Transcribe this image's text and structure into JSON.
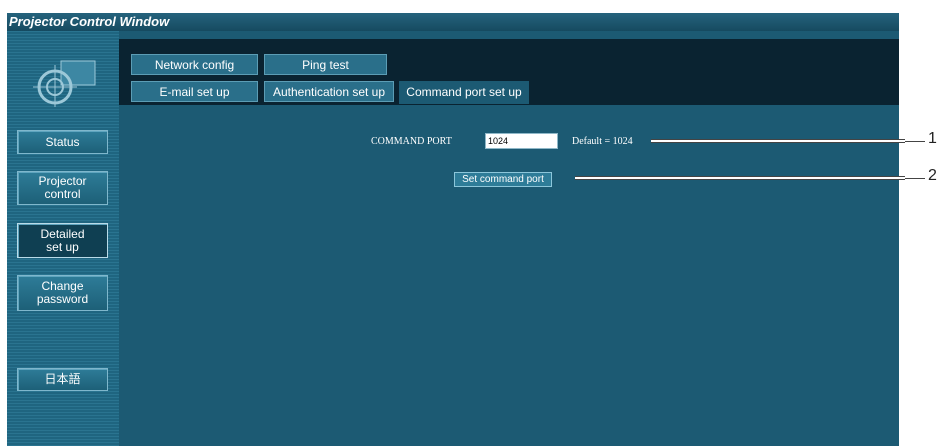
{
  "window": {
    "title": "Projector Control Window"
  },
  "sidebar": {
    "buttons": [
      {
        "label": "Status"
      },
      {
        "label": "Projector\ncontrol"
      },
      {
        "label": "Detailed\nset up"
      },
      {
        "label": "Change\npassword"
      },
      {
        "label": "日本語"
      }
    ],
    "active": "Detailed set up"
  },
  "tabs": {
    "row1": [
      {
        "label": "Network config"
      },
      {
        "label": "Ping test"
      }
    ],
    "row2": [
      {
        "label": "E-mail set up"
      },
      {
        "label": "Authentication set up"
      },
      {
        "label": "Command port set up"
      }
    ],
    "active": "Command port set up"
  },
  "form": {
    "command_port_label": "COMMAND PORT",
    "command_port_value": "1024",
    "default_text": "Default = 1024",
    "set_button_label": "Set command port"
  },
  "callouts": [
    {
      "number": "1"
    },
    {
      "number": "2"
    }
  ],
  "colors": {
    "window_bg": "#1c5a73",
    "nav_bg": "#0a2331",
    "tab_bg": "#2a6f8a",
    "title_text": "#ffffff"
  }
}
